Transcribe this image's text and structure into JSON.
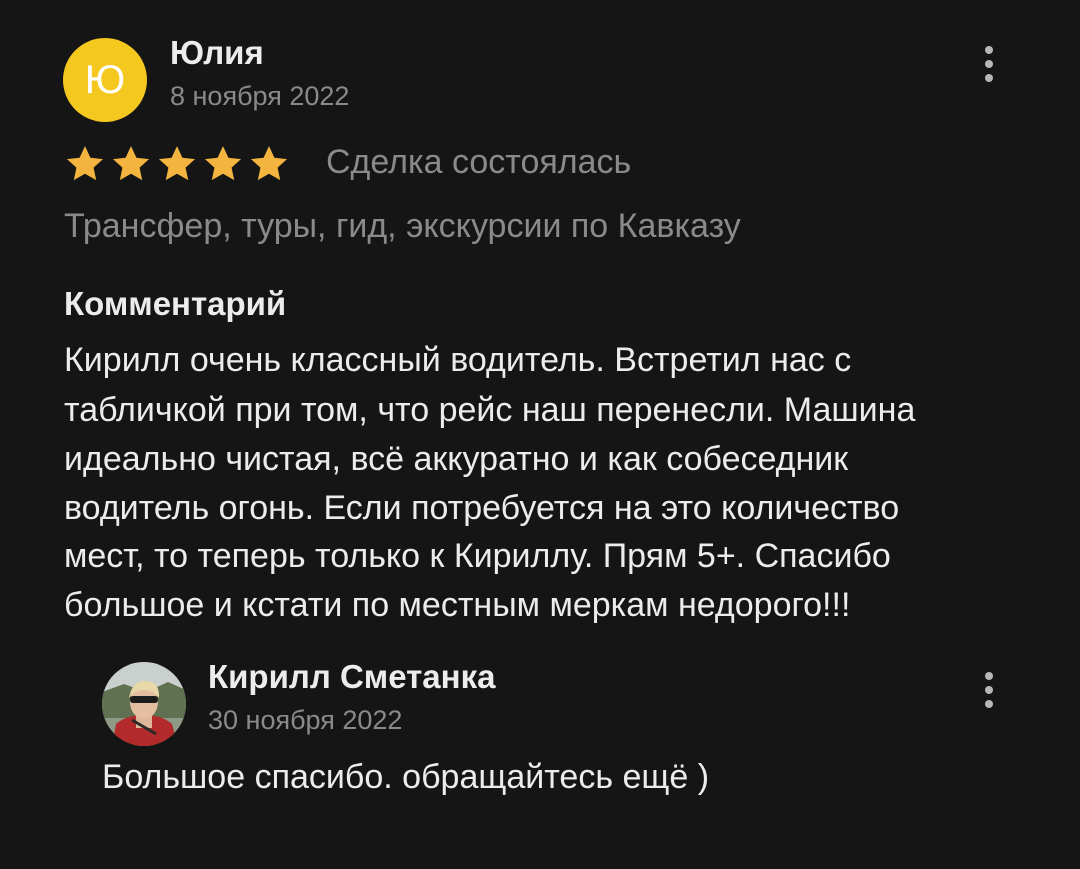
{
  "review": {
    "avatar_letter": "Ю",
    "author": "Юлия",
    "date": "8 ноября 2022",
    "rating": 5,
    "rating_max": 5,
    "deal_status": "Сделка состоялась",
    "category": "Трансфер, туры, гид, экскурсии по Кавказу",
    "comment_heading": "Комментарий",
    "comment_lines": [
      "Кирилл очень классный водитель. Встретил нас с",
      "табличкой при том, что рейс наш перенесли. Машина",
      "идеально чистая, всё аккуратно и как собеседник",
      "водитель огонь. Если потребуется на это количество",
      "мест, то теперь только к Кириллу. Прям 5+. Спасибо",
      "большое и кстати по местным меркам недорого!!!"
    ],
    "menu_icon": "more-vertical-icon"
  },
  "reply": {
    "author": "Кирилл Сметанка",
    "date": "30 ноября 2022",
    "text": "Большое спасибо. обращайтесь ещё )",
    "menu_icon": "more-vertical-icon"
  },
  "colors": {
    "background": "#151515",
    "avatar_yellow": "#f5c81f",
    "star": "#f3b540",
    "primary_text": "#ececec",
    "secondary_text": "#8a8a8a"
  }
}
